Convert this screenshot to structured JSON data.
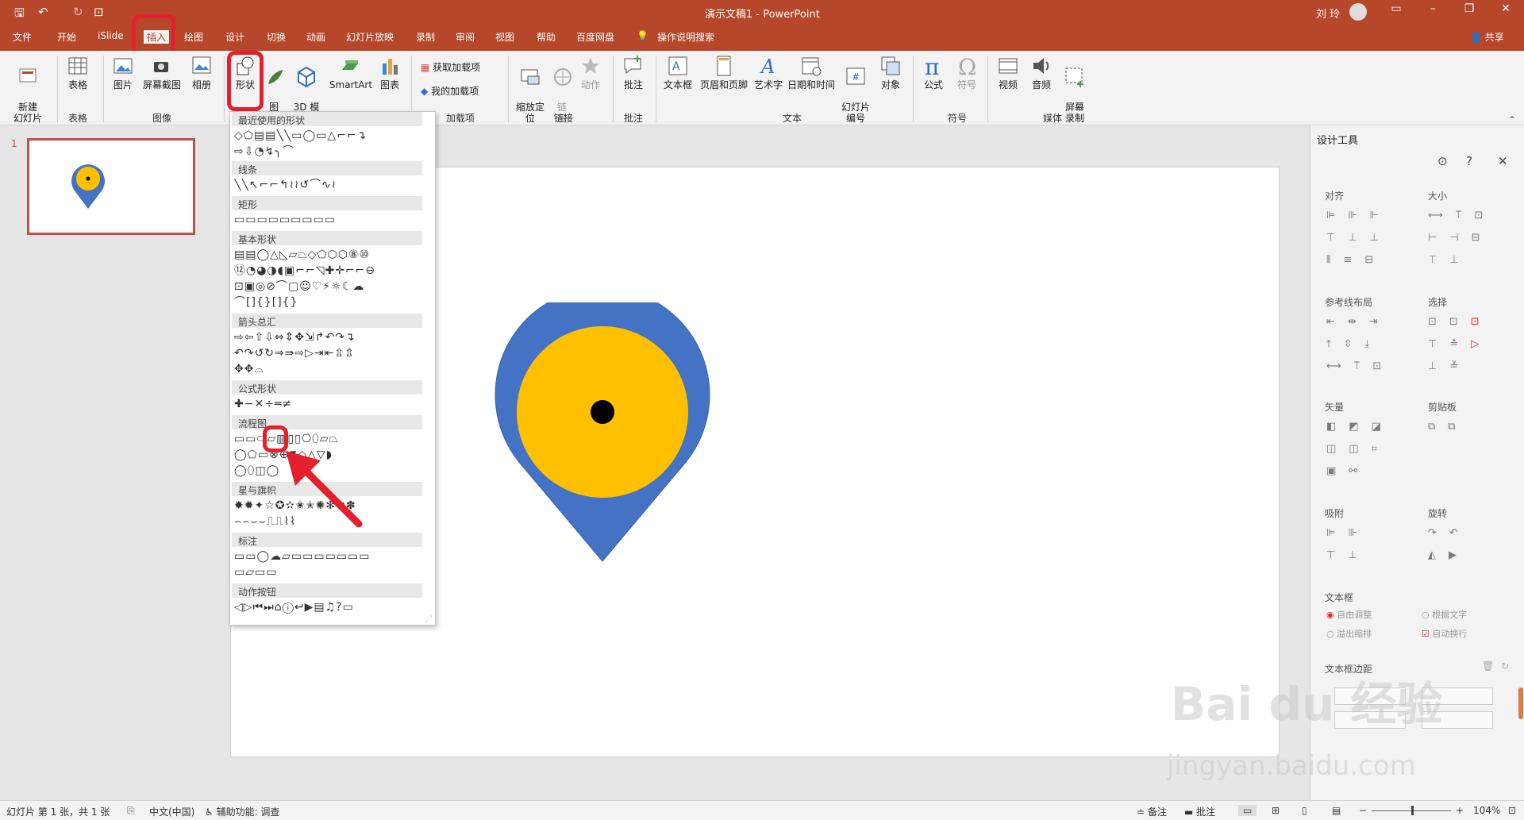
{
  "window": {
    "title": "演示文稿1 - PowerPoint",
    "user": "刘 玲",
    "share": "共享"
  },
  "tabs": [
    "文件",
    "开始",
    "iSlide",
    "插入",
    "绘图",
    "设计",
    "切换",
    "动画",
    "幻灯片放映",
    "录制",
    "审阅",
    "视图",
    "帮助",
    "百度网盘"
  ],
  "tell_me": "操作说明搜索",
  "ribbon": {
    "new_slide": "新建\n幻灯片",
    "table": "表格",
    "picture": "图片",
    "screenshot": "屏幕截图",
    "album": "相册",
    "shapes": "形状",
    "icons": "图\n标",
    "model3d": "3D 模\n型",
    "smartart": "SmartArt",
    "chart": "图表",
    "get_addins": "获取加载项",
    "my_addins": "我的加载项",
    "zoom": "缩放定\n位",
    "link": "链\n接",
    "action": "动作",
    "comment": "批注",
    "textbox": "文本框",
    "header_footer": "页眉和页脚",
    "wordart": "艺术字",
    "datetime": "日期和时间",
    "slide_number": "幻灯片\n编号",
    "object": "对象",
    "equation": "公式",
    "symbol": "符号",
    "video": "视频",
    "audio": "音频",
    "screen_record": "屏幕\n录制",
    "groups": {
      "slides": "幻灯片",
      "tables": "表格",
      "images": "图像",
      "addins": "加载项",
      "links": "链接",
      "comments": "批注",
      "text": "文本",
      "symbols": "符号",
      "media": "媒体"
    }
  },
  "thumbnail_number": "1",
  "shapes_menu": {
    "sections": [
      "最近使用的形状",
      "线条",
      "矩形",
      "基本形状",
      "箭头总汇",
      "公式形状",
      "流程图",
      "星与旗帜",
      "标注",
      "动作按钮"
    ]
  },
  "design_pane": {
    "title": "设计工具",
    "align": "对齐",
    "size": "大小",
    "guides": "参考线布局",
    "select": "选择",
    "vector": "矢量",
    "clipboard": "剪贴板",
    "snap": "吸附",
    "rotate": "旋转",
    "textbox": "文本框",
    "auto_fit": "自由调整",
    "fit_text": "根据文字",
    "shrink": "溢出缩排",
    "wrap": "自动换行",
    "margins": "文本框边距"
  },
  "status": {
    "slide_info": "幻灯片 第 1 张，共 1 张",
    "language": "中文(中国)",
    "accessibility": "辅助功能: 调查",
    "notes": "备注",
    "comments": "批注",
    "zoom": "104%"
  },
  "colors": {
    "accent": "#b7472a",
    "pin_outer": "#4472c4",
    "pin_inner": "#ffc000",
    "highlight": "#e3202b"
  },
  "watermark": {
    "brand": "Bai du 经验",
    "url": "jingyan.baidu.com"
  }
}
